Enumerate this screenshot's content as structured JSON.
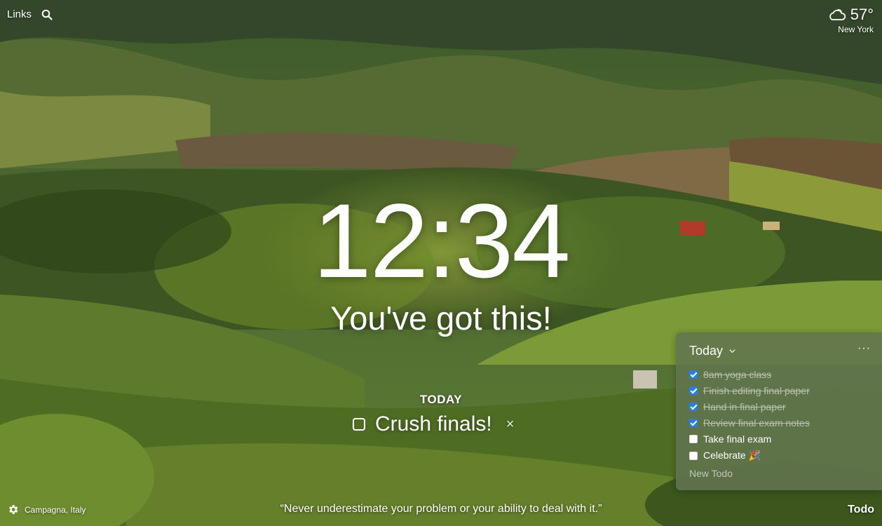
{
  "top_left": {
    "links_label": "Links",
    "search_icon": "search-icon"
  },
  "weather": {
    "icon": "cloud-icon",
    "temperature": "57°",
    "location": "New York"
  },
  "clock": {
    "time": "12:34"
  },
  "mantra": {
    "text": "You've got this!"
  },
  "focus": {
    "label": "TODAY",
    "text": "Crush finals!",
    "clear": "×"
  },
  "todo_panel": {
    "title": "Today",
    "more": "···",
    "items": [
      {
        "text": "8am yoga class",
        "done": true
      },
      {
        "text": "Finish editing final paper",
        "done": true
      },
      {
        "text": "Hand in final paper",
        "done": true
      },
      {
        "text": "Review final exam notes",
        "done": true
      },
      {
        "text": "Take final exam",
        "done": false
      },
      {
        "text": "Celebrate 🎉",
        "done": false
      }
    ],
    "new_placeholder": "New Todo"
  },
  "footer": {
    "settings_icon": "gear-icon",
    "photo_location": "Campagna, Italy",
    "quote": "“Never underestimate your problem or your ability to deal with it.”",
    "todo_toggle": "Todo"
  },
  "colors": {
    "checkbox_checked": "#2a7de1",
    "panel_bg": "#62744e"
  }
}
